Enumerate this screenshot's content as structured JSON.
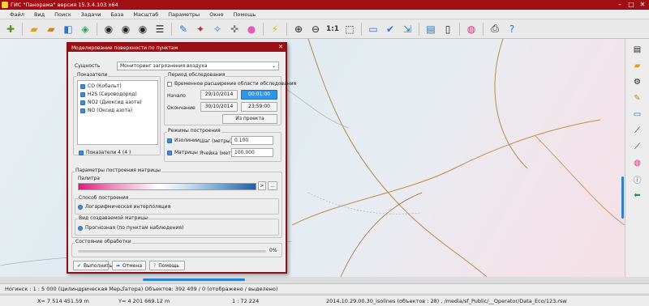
{
  "window": {
    "title": "ГИС \"Панорама\" версия 15.3.4.103 x64"
  },
  "menu": [
    "Файл",
    "Вид",
    "Поиск",
    "Задачи",
    "База",
    "Масштаб",
    "Параметры",
    "Окно",
    "Помощь"
  ],
  "toolbar": {
    "scale_label": "1:1"
  },
  "dialog": {
    "title": "Моделирование поверхности по пунктам",
    "entity_label": "Сущность",
    "entity_value": "Мониторинг загрязнения воздуха",
    "indicators_group": "Показатели",
    "indicators": [
      "CO (Кобальт)",
      "H2S (Сероводород)",
      "NO2 (Диоксид азота)",
      "NO (Оксид азота)"
    ],
    "indicators_count": "Показатели 4 (4 )",
    "period_group": "Период обследования",
    "temp_extension": "Временное расширение области обследования",
    "start_label": "Начало",
    "start_date": "29/10/2014",
    "start_time": "00:01:00",
    "end_label": "Окончание",
    "end_date": "30/10/2014",
    "end_time": "23:59:00",
    "from_project": "Из проекта",
    "modes_group": "Режимы построения",
    "isolines_label": "Изолинии",
    "step_label": "Шаг (метры)",
    "step_value": "0.100",
    "matrices_label": "Матрицы",
    "cell_label": "Ячейка (метры)",
    "cell_value": "100.000",
    "matrix_params_group": "Параметры построения матрицы",
    "palette_label": "Палитра",
    "palette_btn1": ">",
    "palette_btn2": "...",
    "method_group": "Способ построения",
    "method_value": "Логарифмическая интерполяция",
    "matrix_type_group": "Вид создаваемой матрицы",
    "matrix_type_value": "Прогнозная (по пунктам наблюдения)",
    "processing_group": "Состояние обработки",
    "progress_percent": "0%",
    "btn_run": "Выполнить",
    "btn_cancel": "Отмена",
    "btn_help": "Помощь"
  },
  "status": {
    "line1": "Ногинск : 1 : 5 000 (Цилиндрическая Мерکатора) Объектов: 392 409 / 0 (отображено / выделено)",
    "x_coord": "X= 7 514 451.59 m",
    "y_coord": "Y= 4 201 669.12 m",
    "scale": "1 : 72 224",
    "layer_info": "2014.10.29.00.30_isolines   (объектов : 28) ,  /media/sf_Public/__Operator/Data_Eco/123.rsw"
  },
  "colors": {
    "title_bg": "#a10f14",
    "accent_blue": "#2f95e6"
  }
}
